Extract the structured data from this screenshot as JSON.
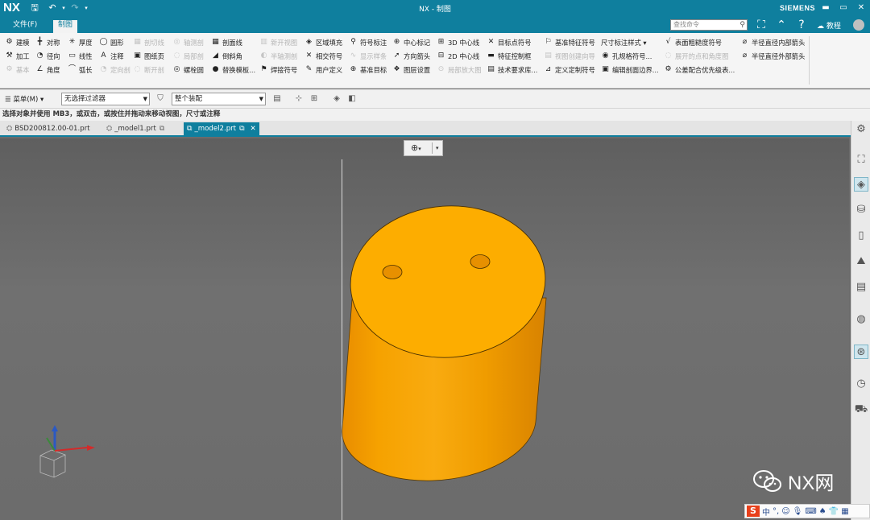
{
  "app": {
    "logo": "NX",
    "window_title": "NX - 制图",
    "brand": "SIEMENS"
  },
  "menubar": {
    "file_label": "文件(F)",
    "active_tab": "制图",
    "search_placeholder": "查找命令",
    "help_label": "教程"
  },
  "ribbon": {
    "columns": [
      [
        {
          "label": "建模",
          "icon": "⚙",
          "enabled": true
        },
        {
          "label": "加工",
          "icon": "⚒",
          "enabled": true
        },
        {
          "label": "基本",
          "icon": "⚙",
          "enabled": false
        }
      ],
      [
        {
          "label": "对称",
          "icon": "╋",
          "enabled": true
        },
        {
          "label": "径向",
          "icon": "◔",
          "enabled": true
        },
        {
          "label": "角度",
          "icon": "∠",
          "enabled": true
        }
      ],
      [
        {
          "label": "厚度",
          "icon": "✳",
          "enabled": true
        },
        {
          "label": "线性",
          "icon": "▭",
          "enabled": true
        },
        {
          "label": "弧长",
          "icon": "⌒",
          "enabled": true
        }
      ],
      [
        {
          "label": "圆形",
          "icon": "◯",
          "enabled": true
        },
        {
          "label": "注释",
          "icon": "A",
          "enabled": true
        },
        {
          "label": "定向剖",
          "icon": "◔",
          "enabled": false
        }
      ],
      [
        {
          "label": "剖切线",
          "icon": "▦",
          "enabled": false
        },
        {
          "label": "图纸页",
          "icon": "▣",
          "enabled": true
        },
        {
          "label": "断开剖",
          "icon": "◌",
          "enabled": false
        }
      ],
      [
        {
          "label": "轴测剖",
          "icon": "◎",
          "enabled": false
        },
        {
          "label": "局部剖",
          "icon": "◌",
          "enabled": false
        },
        {
          "label": "螺栓圆",
          "icon": "◎",
          "enabled": true
        }
      ],
      [
        {
          "label": "剖面线",
          "icon": "▦",
          "enabled": true
        },
        {
          "label": "倒斜角",
          "icon": "◢",
          "enabled": true
        },
        {
          "label": "替换模板...",
          "icon": "●",
          "enabled": true
        }
      ],
      [
        {
          "label": "新开视图",
          "icon": "▥",
          "enabled": false
        },
        {
          "label": "半轴测剖",
          "icon": "◐",
          "enabled": false
        },
        {
          "label": "焊接符号",
          "icon": "⚑",
          "enabled": true
        }
      ],
      [
        {
          "label": "区域填充",
          "icon": "◈",
          "enabled": true
        },
        {
          "label": "相交符号",
          "icon": "✕",
          "enabled": true
        },
        {
          "label": "用户定义",
          "icon": "✎",
          "enabled": true
        }
      ],
      [
        {
          "label": "符号标注",
          "icon": "⚲",
          "enabled": true
        },
        {
          "label": "显示样条",
          "icon": "∿",
          "enabled": false
        },
        {
          "label": "基准目标",
          "icon": "⊕",
          "enabled": true
        }
      ],
      [
        {
          "label": "中心标记",
          "icon": "⊕",
          "enabled": true
        },
        {
          "label": "方向箭头",
          "icon": "➚",
          "enabled": true
        },
        {
          "label": "图层设置",
          "icon": "❖",
          "enabled": true
        }
      ],
      [
        {
          "label": "3D 中心线",
          "icon": "⊞",
          "enabled": true
        },
        {
          "label": "2D 中心线",
          "icon": "⊟",
          "enabled": true
        },
        {
          "label": "局部放大图",
          "icon": "⊙",
          "enabled": false
        }
      ],
      [
        {
          "label": "目标点符号",
          "icon": "✕",
          "enabled": true
        },
        {
          "label": "特征控制框",
          "icon": "▬",
          "enabled": true
        },
        {
          "label": "技术要求库...",
          "icon": "▤",
          "enabled": true
        }
      ],
      [
        {
          "label": "基准特征符号",
          "icon": "⚐",
          "enabled": true
        },
        {
          "label": "视图创建向导",
          "icon": "▤",
          "enabled": false
        },
        {
          "label": "定义定制符号",
          "icon": "⊿",
          "enabled": true
        }
      ],
      [
        {
          "label": "尺寸标注样式 ▾",
          "icon": "",
          "enabled": true
        },
        {
          "label": "孔规格符号...",
          "icon": "◉",
          "enabled": true
        },
        {
          "label": "编辑剖面边界...",
          "icon": "▣",
          "enabled": true
        }
      ],
      [
        {
          "label": "表面粗糙度符号",
          "icon": "√",
          "enabled": true
        },
        {
          "label": "展开的点和角度图",
          "icon": "◌",
          "enabled": false
        },
        {
          "label": "公差配合优先级表...",
          "icon": "⚙",
          "enabled": true
        }
      ],
      [
        {
          "label": "半径直径内部箭头",
          "icon": "⌀",
          "enabled": true
        },
        {
          "label": "半径直径外部箭头",
          "icon": "⌀",
          "enabled": true
        }
      ]
    ]
  },
  "toolbar": {
    "menu_label": "菜单(M) ▾",
    "filter_value": "无选择过滤器",
    "scope_value": "整个装配"
  },
  "status_text": "选择对象并使用 MB3，或双击，或按住并拖动来移动视图，尺寸或注释",
  "doc_tabs": [
    {
      "label": "BSD200812.00-01.prt",
      "active": false
    },
    {
      "label": "_model1.prt",
      "active": false
    },
    {
      "label": "_model2.prt",
      "active": true
    }
  ],
  "watermark": "NX网",
  "ime": {
    "lang": "中"
  },
  "colors": {
    "accent": "#0f7f9e",
    "part": "#f7a800",
    "viewport": "#6b6b6b"
  }
}
